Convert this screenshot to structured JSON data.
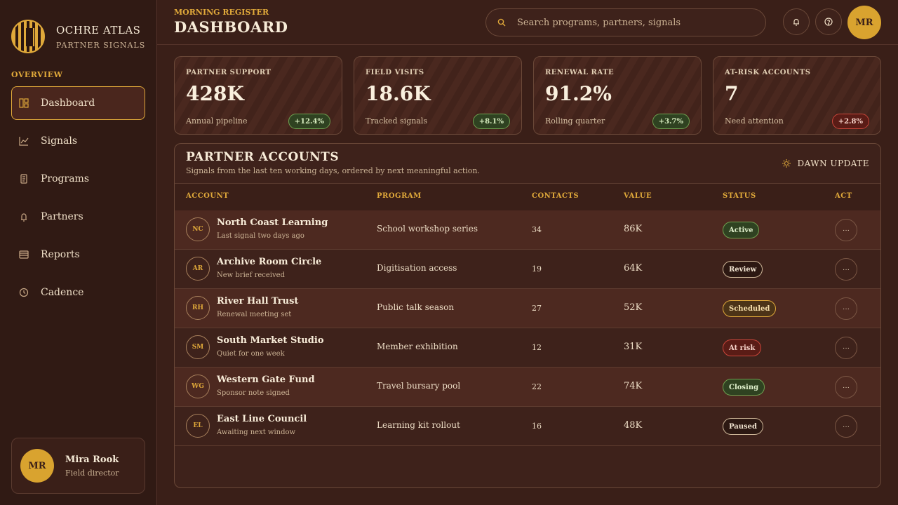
{
  "brand": {
    "name": "OCHRE ATLAS",
    "subtitle": "PARTNER SIGNALS",
    "logo_icon": "ochre-stripes-logo"
  },
  "sidebar": {
    "section_label": "OVERVIEW",
    "items": [
      {
        "label": "Dashboard",
        "icon": "dashboard-icon",
        "active": true
      },
      {
        "label": "Signals",
        "icon": "line-chart-icon"
      },
      {
        "label": "Programs",
        "icon": "document-icon"
      },
      {
        "label": "Partners",
        "icon": "bell-person-icon"
      },
      {
        "label": "Reports",
        "icon": "report-icon"
      },
      {
        "label": "Cadence",
        "icon": "clock-icon"
      }
    ]
  },
  "profile": {
    "initials": "MR",
    "name": "Mira Rook",
    "role": "Field director"
  },
  "header": {
    "eyebrow": "MORNING REGISTER",
    "title": "DASHBOARD",
    "search_placeholder": "Search programs, partners, signals",
    "avatar_initials": "MR"
  },
  "stats": [
    {
      "label": "PARTNER SUPPORT",
      "value": "428K",
      "foot": "Annual pipeline",
      "delta": "+12.4%",
      "trend": "up"
    },
    {
      "label": "FIELD VISITS",
      "value": "18.6K",
      "foot": "Tracked signals",
      "delta": "+8.1%",
      "trend": "up"
    },
    {
      "label": "RENEWAL RATE",
      "value": "91.2%",
      "foot": "Rolling quarter",
      "delta": "+3.7%",
      "trend": "up"
    },
    {
      "label": "AT-RISK ACCOUNTS",
      "value": "7",
      "foot": "Need attention",
      "delta": "+2.8%",
      "trend": "down"
    }
  ],
  "panel": {
    "title": "PARTNER ACCOUNTS",
    "subtitle": "Signals from the last ten working days, ordered by next meaningful action.",
    "action_label": "DAWN UPDATE",
    "columns": {
      "account": "ACCOUNT",
      "program": "PROGRAM",
      "contacts": "CONTACTS",
      "value": "VALUE",
      "status": "STATUS",
      "act": "ACT"
    },
    "rows": [
      {
        "initials": "NC",
        "name": "North Coast Learning",
        "note": "Last signal two days ago",
        "program": "School workshop series",
        "contacts": "34",
        "value": "86K",
        "status": "Active",
        "status_kind": "active"
      },
      {
        "initials": "AR",
        "name": "Archive Room Circle",
        "note": "New brief received",
        "program": "Digitisation access",
        "contacts": "19",
        "value": "64K",
        "status": "Review",
        "status_kind": "review"
      },
      {
        "initials": "RH",
        "name": "River Hall Trust",
        "note": "Renewal meeting set",
        "program": "Public talk season",
        "contacts": "27",
        "value": "52K",
        "status": "Scheduled",
        "status_kind": "scheduled"
      },
      {
        "initials": "SM",
        "name": "South Market Studio",
        "note": "Quiet for one week",
        "program": "Member exhibition",
        "contacts": "12",
        "value": "31K",
        "status": "At risk",
        "status_kind": "atrisk"
      },
      {
        "initials": "WG",
        "name": "Western Gate Fund",
        "note": "Sponsor note signed",
        "program": "Travel bursary pool",
        "contacts": "22",
        "value": "74K",
        "status": "Closing",
        "status_kind": "closing"
      },
      {
        "initials": "EL",
        "name": "East Line Council",
        "note": "Awaiting next window",
        "program": "Learning kit rollout",
        "contacts": "16",
        "value": "48K",
        "status": "Paused",
        "status_kind": "paused"
      }
    ],
    "more_label": "···"
  },
  "colors": {
    "accent": "#e0a93a",
    "background": "#3a1f18",
    "positive": "#6fa050",
    "negative": "#c9463a"
  }
}
